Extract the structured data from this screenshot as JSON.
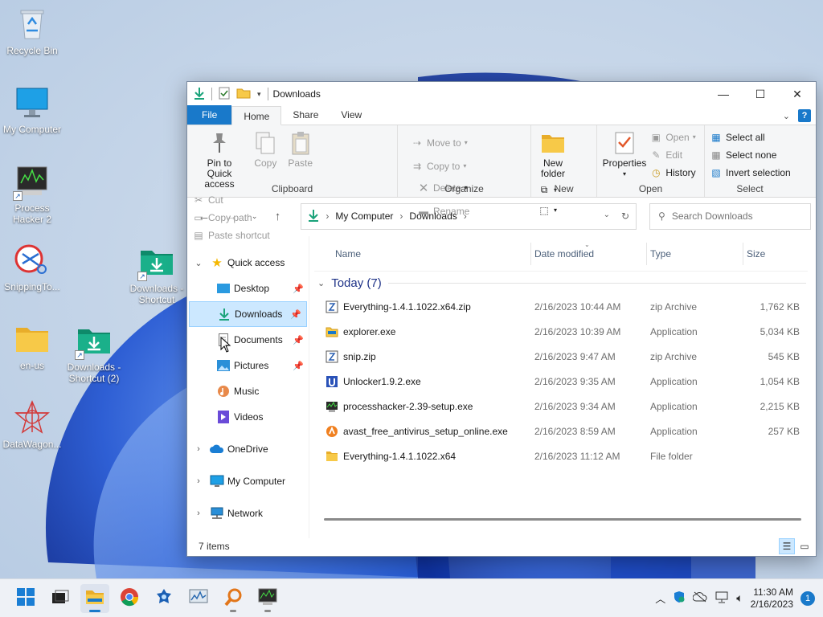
{
  "desktop": {
    "icons": [
      {
        "name": "recycle-bin",
        "label": "Recycle Bin"
      },
      {
        "name": "my-computer",
        "label": "My Computer"
      },
      {
        "name": "process-hacker",
        "label": "Process Hacker 2"
      },
      {
        "name": "snipping-tool",
        "label": "SnippingTo..."
      },
      {
        "name": "en-us",
        "label": "en-us"
      },
      {
        "name": "datawagon",
        "label": "DataWagon..."
      },
      {
        "name": "downloads-shortcut",
        "label": "Downloads - Shortcut"
      },
      {
        "name": "downloads-shortcut-2",
        "label": "Downloads - Shortcut (2)"
      }
    ]
  },
  "window": {
    "title": "Downloads",
    "controls": {
      "minimize": "—",
      "maximize": "☐",
      "close": "✕"
    }
  },
  "ribbon": {
    "tabs": [
      "File",
      "Home",
      "Share",
      "View"
    ],
    "active_tab": "Home",
    "clipboard": {
      "pin": "Pin to Quick access",
      "copy": "Copy",
      "paste": "Paste",
      "cut": "Cut",
      "copy_path": "Copy path",
      "paste_shortcut": "Paste shortcut",
      "label": "Clipboard"
    },
    "organize": {
      "move_to": "Move to",
      "copy_to": "Copy to",
      "delete": "Delete",
      "rename": "Rename",
      "label": "Organize"
    },
    "new": {
      "new_folder": "New folder",
      "label": "New"
    },
    "open": {
      "properties": "Properties",
      "open": "Open",
      "edit": "Edit",
      "history": "History",
      "label": "Open"
    },
    "select": {
      "select_all": "Select all",
      "select_none": "Select none",
      "invert": "Invert selection",
      "label": "Select"
    }
  },
  "address": {
    "crumbs": [
      "My Computer",
      "Downloads"
    ],
    "search_placeholder": "Search Downloads"
  },
  "nav": {
    "quick_access": "Quick access",
    "items": [
      {
        "label": "Desktop",
        "pinned": true
      },
      {
        "label": "Downloads",
        "pinned": true,
        "selected": true
      },
      {
        "label": "Documents",
        "pinned": true
      },
      {
        "label": "Pictures",
        "pinned": true
      },
      {
        "label": "Music",
        "pinned": false
      },
      {
        "label": "Videos",
        "pinned": false
      }
    ],
    "onedrive": "OneDrive",
    "my_computer": "My Computer",
    "network": "Network"
  },
  "files": {
    "columns": [
      "Name",
      "Date modified",
      "Type",
      "Size"
    ],
    "group": "Today (7)",
    "rows": [
      {
        "name": "Everything-1.4.1.1022.x64.zip",
        "date": "2/16/2023 10:44 AM",
        "type": "zip Archive",
        "size": "1,762 KB",
        "icon": "zip-icon"
      },
      {
        "name": "explorer.exe",
        "date": "2/16/2023 10:39 AM",
        "type": "Application",
        "size": "5,034 KB",
        "icon": "explorer-exe-icon"
      },
      {
        "name": "snip.zip",
        "date": "2/16/2023 9:47 AM",
        "type": "zip Archive",
        "size": "545 KB",
        "icon": "zip-icon"
      },
      {
        "name": "Unlocker1.9.2.exe",
        "date": "2/16/2023 9:35 AM",
        "type": "Application",
        "size": "1,054 KB",
        "icon": "unlocker-icon"
      },
      {
        "name": "processhacker-2.39-setup.exe",
        "date": "2/16/2023 9:34 AM",
        "type": "Application",
        "size": "2,215 KB",
        "icon": "processhacker-icon"
      },
      {
        "name": "avast_free_antivirus_setup_online.exe",
        "date": "2/16/2023 8:59 AM",
        "type": "Application",
        "size": "257 KB",
        "icon": "avast-icon"
      },
      {
        "name": "Everything-1.4.1.1022.x64",
        "date": "2/16/2023 11:12 AM",
        "type": "File folder",
        "size": "",
        "icon": "folder-icon"
      }
    ]
  },
  "status": {
    "items": "7 items"
  },
  "taskbar": {
    "apps": [
      "start",
      "task-view",
      "file-explorer",
      "chrome",
      "app-blue",
      "resource-monitor",
      "search-magnifier",
      "process-hacker"
    ],
    "time": "11:30 AM",
    "date": "2/16/2023",
    "notifications": "1"
  },
  "colors": {
    "accent": "#1979ca",
    "selection": "#cce8ff",
    "folder": "#f7c948"
  }
}
